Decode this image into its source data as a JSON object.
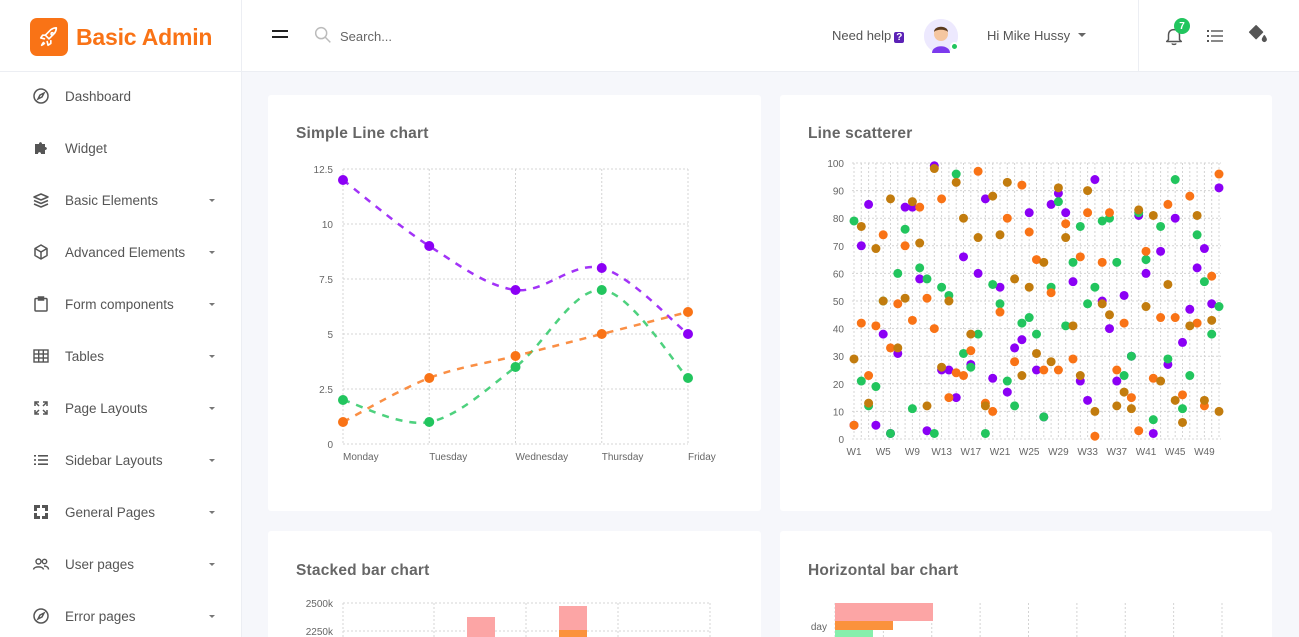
{
  "brand": {
    "name": "Basic Admin",
    "accent": "#f97316"
  },
  "search": {
    "placeholder": "Search..."
  },
  "header": {
    "help_label": "Need help",
    "help_mark": "?",
    "user_greeting": "Hi Mike Hussy",
    "notification_count": "7"
  },
  "sidebar": {
    "items": [
      {
        "label": "Dashboard",
        "icon": "compass-icon",
        "caret": false
      },
      {
        "label": "Widget",
        "icon": "puzzle-icon",
        "caret": false
      },
      {
        "label": "Basic Elements",
        "icon": "layers-icon",
        "caret": true
      },
      {
        "label": "Advanced Elements",
        "icon": "cube-icon",
        "caret": true
      },
      {
        "label": "Form components",
        "icon": "clipboard-icon",
        "caret": true
      },
      {
        "label": "Tables",
        "icon": "table-icon",
        "caret": true
      },
      {
        "label": "Page Layouts",
        "icon": "expand-icon",
        "caret": true
      },
      {
        "label": "Sidebar Layouts",
        "icon": "list-icon",
        "caret": true
      },
      {
        "label": "General Pages",
        "icon": "frame-icon",
        "caret": true
      },
      {
        "label": "User pages",
        "icon": "users-icon",
        "caret": true
      },
      {
        "label": "Error pages",
        "icon": "compass-icon",
        "caret": true
      }
    ]
  },
  "cards": {
    "line": {
      "title": "Simple Line chart"
    },
    "scatter": {
      "title": "Line scatterer"
    },
    "stacked": {
      "title": "Stacked bar chart"
    },
    "hbar": {
      "title": "Horizontal bar chart"
    }
  },
  "chart_data": [
    {
      "type": "line",
      "title": "Simple Line chart",
      "categories": [
        "Monday",
        "Tuesday",
        "Wednesday",
        "Thursday",
        "Friday"
      ],
      "ytick_labels": [
        "0",
        "2.5",
        "5",
        "7.5",
        "10",
        "12.5"
      ],
      "ylim": [
        0,
        12.5
      ],
      "grid": true,
      "series": [
        {
          "values": [
            12,
            9,
            7,
            8,
            5
          ],
          "color": "#8b00f5"
        },
        {
          "values": [
            2,
            1,
            3.5,
            7,
            3
          ],
          "color": "#22c55e"
        },
        {
          "values": [
            1,
            3,
            4,
            5,
            6
          ],
          "color": "#f97316"
        }
      ]
    },
    {
      "type": "scatter",
      "title": "Line scatterer",
      "x_labels": [
        "W1",
        "W5",
        "W9",
        "W13",
        "W17",
        "W21",
        "W25",
        "W29",
        "W33",
        "W37",
        "W41",
        "W45",
        "W49"
      ],
      "ytick_labels": [
        "0",
        "10",
        "20",
        "30",
        "40",
        "50",
        "60",
        "70",
        "80",
        "90",
        "100"
      ],
      "ylim": [
        0,
        100
      ],
      "grid": true,
      "series": [
        {
          "color": "#8b00f5",
          "values": [
            5,
            70,
            85,
            5,
            38,
            2,
            31,
            84,
            84,
            58,
            3,
            99,
            25,
            25,
            15,
            66,
            27,
            60,
            87,
            22,
            55,
            17,
            33,
            36,
            82,
            25,
            8,
            85,
            89,
            82,
            57,
            21,
            14,
            94,
            50,
            40,
            21,
            52,
            30,
            81,
            60,
            2,
            68,
            27,
            80,
            35,
            47,
            62,
            69,
            49,
            91
          ]
        },
        {
          "color": "#22c55e",
          "values": [
            79,
            21,
            12,
            19,
            50,
            2,
            60,
            76,
            11,
            62,
            58,
            2,
            55,
            52,
            96,
            31,
            26,
            38,
            2,
            56,
            49,
            21,
            12,
            42,
            44,
            38,
            8,
            55,
            86,
            41,
            64,
            77,
            49,
            55,
            79,
            80,
            64,
            23,
            30,
            82,
            65,
            7,
            77,
            29,
            94,
            11,
            23,
            74,
            57,
            38,
            48
          ]
        },
        {
          "color": "#f97316",
          "values": [
            5,
            42,
            23,
            41,
            74,
            33,
            49,
            70,
            43,
            84,
            51,
            40,
            87,
            15,
            24,
            23,
            32,
            97,
            13,
            10,
            46,
            80,
            28,
            92,
            75,
            65,
            25,
            53,
            25,
            78,
            29,
            66,
            82,
            1,
            64,
            82,
            25,
            42,
            15,
            3,
            68,
            22,
            44,
            85,
            44,
            16,
            88,
            42,
            12,
            59,
            96
          ]
        },
        {
          "color": "#c27c0e",
          "values": [
            29,
            77,
            13,
            69,
            50,
            87,
            33,
            51,
            86,
            71,
            12,
            98,
            26,
            50,
            93,
            80,
            38,
            73,
            12,
            88,
            74,
            93,
            58,
            23,
            55,
            31,
            64,
            28,
            91,
            73,
            41,
            23,
            90,
            10,
            49,
            45,
            12,
            17,
            11,
            83,
            48,
            81,
            21,
            56,
            14,
            6,
            41,
            81,
            14,
            43,
            10
          ]
        }
      ]
    },
    {
      "type": "bar",
      "title": "Stacked bar chart",
      "ytick_labels": [
        "2500k",
        "2250k"
      ],
      "partial": true
    },
    {
      "type": "bar",
      "title": "Horizontal bar chart",
      "categories": [
        "day"
      ],
      "partial": true
    }
  ]
}
